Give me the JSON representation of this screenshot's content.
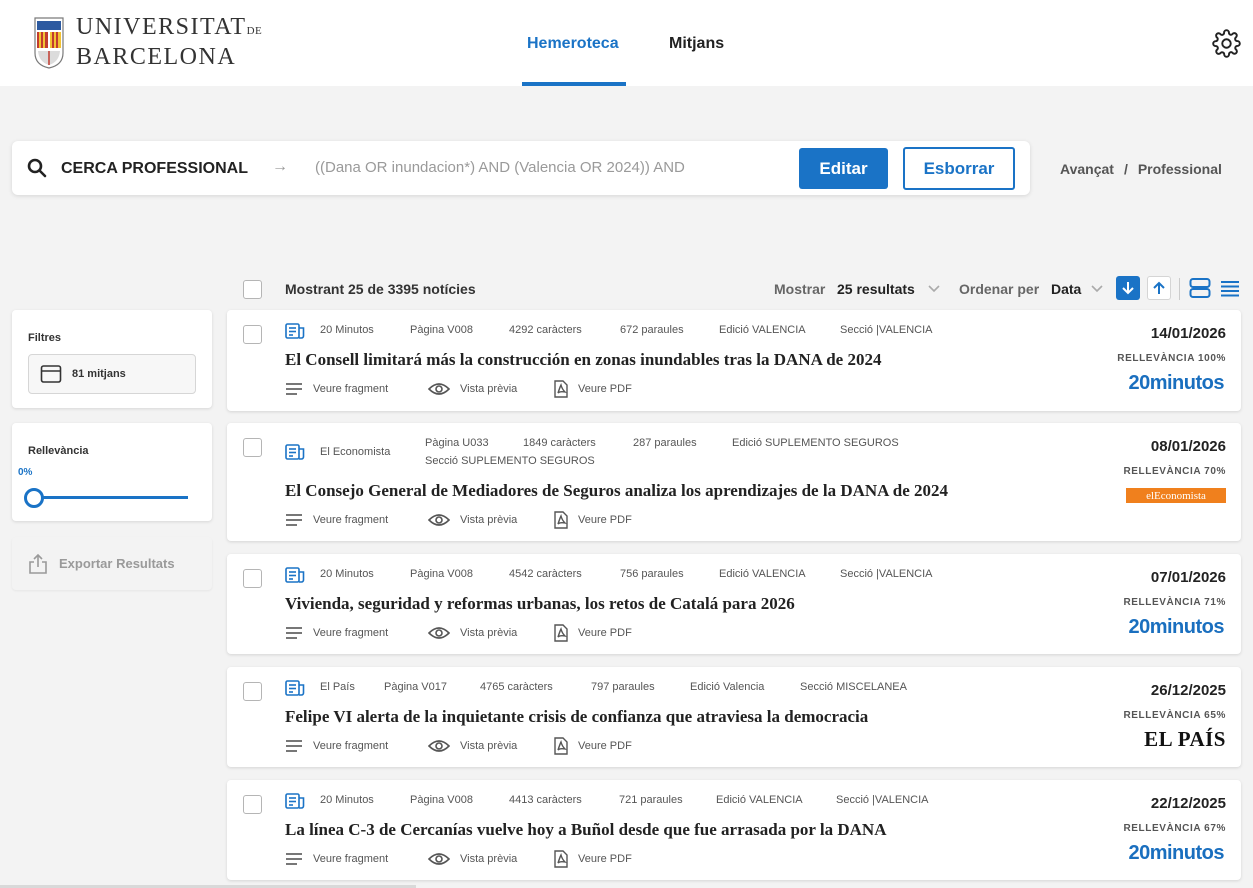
{
  "header": {
    "logo_line1": "UNIVERSITAT",
    "logo_de": "DE",
    "logo_line2": "BARCELONA",
    "tabs": [
      {
        "label": "Hemeroteca",
        "active": true
      },
      {
        "label": "Mitjans",
        "active": false
      }
    ],
    "settings_icon": "gear-icon"
  },
  "search": {
    "label": "CERCA PROFESSIONAL",
    "arrow": "→",
    "query": "((Dana OR inundacion*) AND (Valencia OR 2024)) AND",
    "edit_label": "Editar",
    "clear_label": "Esborrar",
    "mode_advanced": "Avançat",
    "mode_separator": "/",
    "mode_professional": "Professional"
  },
  "toolbar": {
    "showing": "Mostrant 25 de 3395 notícies",
    "show_label": "Mostrar",
    "show_value": "25 resultats",
    "order_label": "Ordenar per",
    "order_value": "Data"
  },
  "sidebar": {
    "filters_title": "Filtres",
    "mitjans_label": "81 mitjans",
    "relevance_title": "Rellevància",
    "relevance_value": "0%",
    "relevance_fraction": 0,
    "export_label": "Exportar Resultats"
  },
  "results": [
    {
      "source": "20 Minutos",
      "page": "Pàgina V008",
      "chars": "4292 caràcters",
      "words": "672 paraules",
      "edition": "Edició VALENCIA",
      "section": "Secció |VALENCIA",
      "title": "El Consell limitará más la construcción en zonas inundables tras la DANA de 2024",
      "date": "14/01/2026",
      "relevance": "RELLEVÀNCIA 100%",
      "logo": "20minutos"
    },
    {
      "source": "El Economista",
      "page": "Pàgina U033",
      "chars": "1849 caràcters",
      "words": "287 paraules",
      "edition": "Edició SUPLEMENTO SEGUROS",
      "section": "Secció SUPLEMENTO SEGUROS",
      "title": "El Consejo General de Mediadores de Seguros analiza los aprendizajes de la DANA de 2024",
      "date": "08/01/2026",
      "relevance": "RELLEVÀNCIA 70%",
      "logo": "elEconomista"
    },
    {
      "source": "20 Minutos",
      "page": "Pàgina V008",
      "chars": "4542 caràcters",
      "words": "756 paraules",
      "edition": "Edició VALENCIA",
      "section": "Secció |VALENCIA",
      "title": "Vivienda, seguridad y reformas urbanas, los retos de Catalá para 2026",
      "date": "07/01/2026",
      "relevance": "RELLEVÀNCIA 71%",
      "logo": "20minutos"
    },
    {
      "source": "El País",
      "page": "Pàgina V017",
      "chars": "4765 caràcters",
      "words": "797 paraules",
      "edition": "Edició Valencia",
      "section": "Secció MISCELANEA",
      "title": "Felipe VI alerta de la inquietante crisis de confianza que atraviesa la democracia",
      "date": "26/12/2025",
      "relevance": "RELLEVÀNCIA 65%",
      "logo": "EL PAÍS"
    },
    {
      "source": "20 Minutos",
      "page": "Pàgina V008",
      "chars": "4413 caràcters",
      "words": "721 paraules",
      "edition": "Edició VALENCIA",
      "section": "Secció |VALENCIA",
      "title": "La línea C-3 de Cercanías vuelve hoy a Buñol desde que fue arrasada por la DANA",
      "date": "22/12/2025",
      "relevance": "RELLEVÀNCIA 67%",
      "logo": "20minutos"
    }
  ],
  "actions": {
    "fragment": "Veure fragment",
    "preview": "Vista prèvia",
    "pdf": "Veure PDF"
  },
  "colors": {
    "accent": "#1a73c6",
    "eleconomista": "#f0801d",
    "twentyminutos": "#1a6fbf"
  }
}
